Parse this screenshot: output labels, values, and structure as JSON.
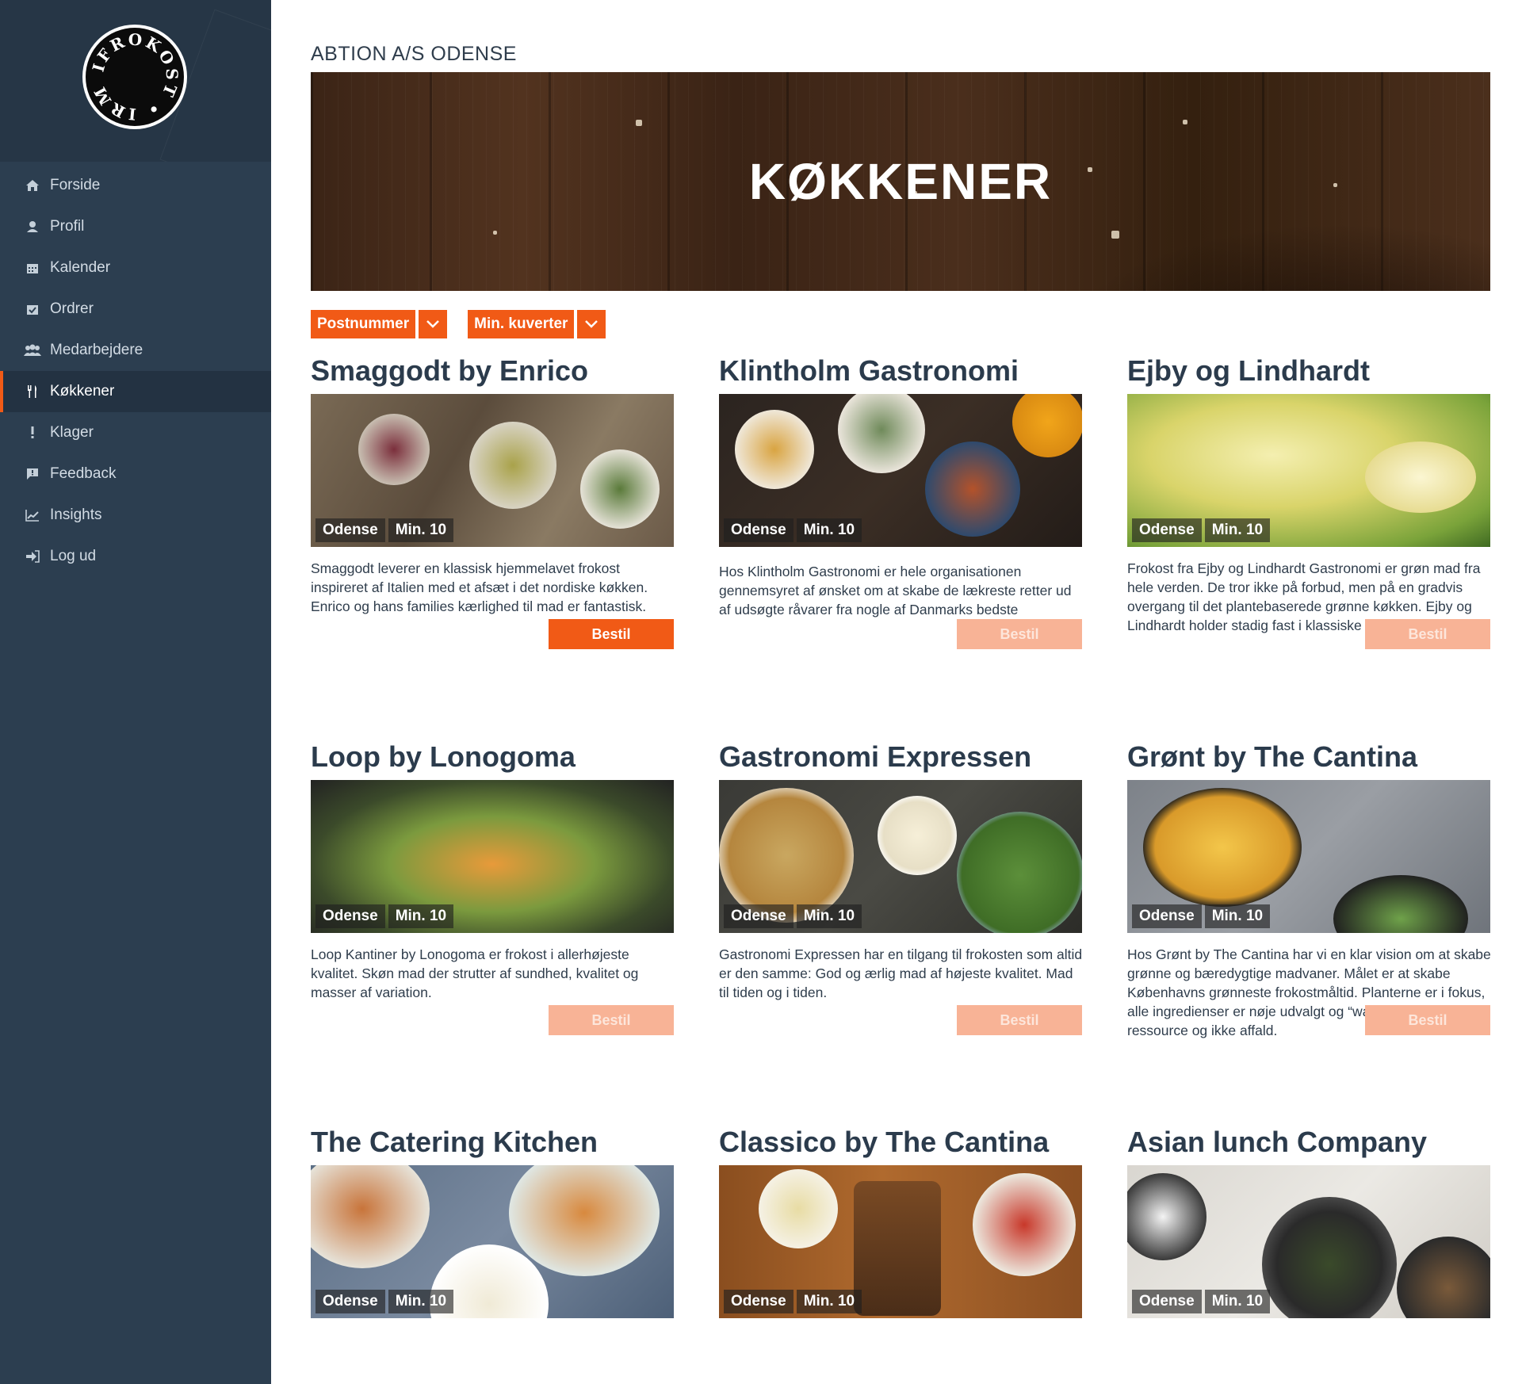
{
  "logo": {
    "text": "FIRMAETFROKOST"
  },
  "nav": [
    {
      "label": "Forside",
      "icon": "home-icon",
      "active": false
    },
    {
      "label": "Profil",
      "icon": "user-icon",
      "active": false
    },
    {
      "label": "Kalender",
      "icon": "calendar-icon",
      "active": false
    },
    {
      "label": "Ordrer",
      "icon": "calendar-check-icon",
      "active": false
    },
    {
      "label": "Medarbejdere",
      "icon": "users-icon",
      "active": false
    },
    {
      "label": "Køkkener",
      "icon": "cutlery-icon",
      "active": true
    },
    {
      "label": "Klager",
      "icon": "exclamation-icon",
      "active": false
    },
    {
      "label": "Feedback",
      "icon": "comment-icon",
      "active": false
    },
    {
      "label": "Insights",
      "icon": "line-chart-icon",
      "active": false
    },
    {
      "label": "Log ud",
      "icon": "sign-out-icon",
      "active": false
    }
  ],
  "company": "ABTION A/S ODENSE",
  "hero": {
    "title": "KØKKENER"
  },
  "filters": [
    {
      "label": "Postnummer"
    },
    {
      "label": "Min. kuverter"
    }
  ],
  "colors": {
    "accent": "#f15a16",
    "accent_dim": "#f8b396",
    "sidebar": "#2c3e50"
  },
  "kitchens": [
    {
      "name": "Smaggodt by Enrico",
      "city": "Odense",
      "min": "Min. 10",
      "description": "Smaggodt leverer en klassisk hjemmelavet frokost inspireret af Italien med et afsæt i det nordiske køkken. Enrico og hans families kærlighed til mad er fantastisk.",
      "order_label": "Bestil",
      "order_enabled": true
    },
    {
      "name": "Klintholm Gastronomi",
      "city": "Odense",
      "min": "Min. 10",
      "description": "Hos Klintholm Gastronomi er hele organisationen gennemsyret af ønsket om at skabe de lækreste retter ud af udsøgte råvarer fra nogle af Danmarks bedste",
      "order_label": "Bestil",
      "order_enabled": false
    },
    {
      "name": "Ejby og Lindhardt",
      "city": "Odense",
      "min": "Min. 10",
      "description": "Frokost fra Ejby og Lindhardt Gastronomi er grøn mad fra hele verden. De tror ikke på forbud, men på en gradvis overgang til det plantebaserede grønne køkken. Ejby og Lindhardt holder stadig fast i klassiske danske traditioner.",
      "order_label": "Bestil",
      "order_enabled": false
    },
    {
      "name": "Loop by Lonogoma",
      "city": "Odense",
      "min": "Min. 10",
      "description": "Loop Kantiner by Lonogoma er frokost i allerhøjeste kvalitet. Skøn mad der strutter af sundhed, kvalitet og masser af variation.",
      "order_label": "Bestil",
      "order_enabled": false
    },
    {
      "name": "Gastronomi Expressen",
      "city": "Odense",
      "min": "Min. 10",
      "description": "Gastronomi Expressen har en tilgang til frokosten som altid er den samme: God og ærlig mad af højeste kvalitet. Mad til tiden og i tiden.",
      "order_label": "Bestil",
      "order_enabled": false
    },
    {
      "name": "Grønt by The Cantina",
      "city": "Odense",
      "min": "Min. 10",
      "description": "Hos Grønt by The Cantina har vi en klar vision om at skabe grønne og bæredygtige madvaner. Målet er at skabe Københavns grønneste frokostmåltid. Planterne er i fokus, alle ingredienser er nøje udvalgt og “waste” ses som en ressource og ikke affald.",
      "order_label": "Bestil",
      "order_enabled": false
    },
    {
      "name": "The Catering Kitchen",
      "city": "Odense",
      "min": "Min. 10",
      "description": "",
      "order_label": "",
      "order_enabled": false
    },
    {
      "name": "Classico by The Cantina",
      "city": "Odense",
      "min": "Min. 10",
      "description": "",
      "order_label": "",
      "order_enabled": false
    },
    {
      "name": "Asian lunch Company",
      "city": "Odense",
      "min": "Min. 10",
      "description": "",
      "order_label": "",
      "order_enabled": false
    }
  ]
}
